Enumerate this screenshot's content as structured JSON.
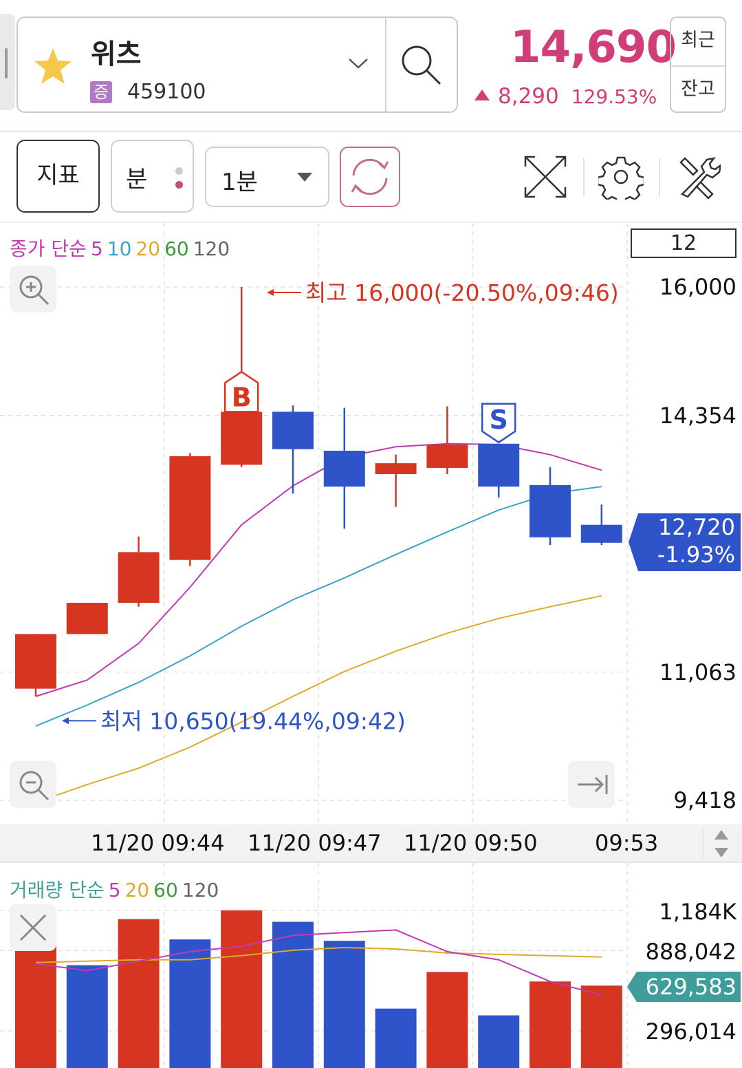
{
  "header": {
    "stock_name": "위츠",
    "market_badge": "증",
    "stock_code": "459100",
    "price": "14,690",
    "change": "8,290",
    "change_pct": "129.53%",
    "recent_label": "최근",
    "balance_label": "잔고"
  },
  "toolbar": {
    "indicator_label": "지표",
    "unit_label": "분",
    "period_value": "1분"
  },
  "colors": {
    "up": "#d63522",
    "down": "#2f54c9",
    "ma5": "#c13ab4",
    "ma10": "#3aa3c7",
    "ma20": "#e0a92b",
    "ma60": "#3c9a3c",
    "ma120": "#666666",
    "price_red": "#d13d78",
    "vol_tag": "#3f9e9b"
  },
  "chart_data": [
    {
      "type": "candlestick",
      "legend": [
        {
          "text": "종가 단순",
          "color": "#c13ab4"
        },
        {
          "text": "5",
          "color": "#c13ab4"
        },
        {
          "text": "10",
          "color": "#3aa3c7"
        },
        {
          "text": "20",
          "color": "#e0a92b"
        },
        {
          "text": "60",
          "color": "#3c9a3c"
        },
        {
          "text": "120",
          "color": "#666666"
        }
      ],
      "visible_count": "12",
      "y_ticks": [
        "16,000",
        "14,354",
        "11,063",
        "9,418"
      ],
      "y_tick_values": [
        16000,
        14354,
        11063,
        9418
      ],
      "x_ticks": [
        "11/20 09:44",
        "11/20 09:47",
        "11/20 09:50",
        "09:53"
      ],
      "x_tick_index": [
        3,
        6,
        9,
        12
      ],
      "candles": [
        {
          "open": 10850,
          "high": 11550,
          "low": 10750,
          "close": 11550
        },
        {
          "open": 11550,
          "high": 11950,
          "low": 11550,
          "close": 11950
        },
        {
          "open": 11950,
          "high": 12800,
          "low": 11900,
          "close": 12600
        },
        {
          "open": 12500,
          "high": 13870,
          "low": 12420,
          "close": 13830
        },
        {
          "open": 13720,
          "high": 16000,
          "low": 13690,
          "close": 14400
        },
        {
          "open": 14400,
          "high": 14480,
          "low": 13350,
          "close": 13920
        },
        {
          "open": 13900,
          "high": 14450,
          "low": 12900,
          "close": 13440
        },
        {
          "open": 13600,
          "high": 13850,
          "low": 13180,
          "close": 13740
        },
        {
          "open": 13680,
          "high": 14470,
          "low": 13600,
          "close": 13980
        },
        {
          "open": 13990,
          "high": 13990,
          "low": 13300,
          "close": 13440
        },
        {
          "open": 13460,
          "high": 13690,
          "low": 12690,
          "close": 12790
        },
        {
          "open": 12950,
          "high": 13210,
          "low": 12690,
          "close": 12720
        }
      ],
      "ma5": [
        10750,
        10960,
        11430,
        12150,
        12950,
        13450,
        13820,
        13950,
        13990,
        13980,
        13850,
        13650
      ],
      "ma10": [
        10370,
        10640,
        10930,
        11270,
        11650,
        11990,
        12270,
        12570,
        12860,
        13140,
        13350,
        13440
      ],
      "ma20": [
        9390,
        9620,
        9830,
        10100,
        10420,
        10750,
        11070,
        11330,
        11560,
        11750,
        11900,
        12040
      ],
      "high_annotation": "최고 16,000(-20.50%,09:46)",
      "low_annotation": "최저 10,650(19.44%,09:42)",
      "low_marker_value": 10650,
      "buy_marker": "B",
      "sell_marker": "S",
      "buy_index": 4,
      "sell_index": 9,
      "current_price": "12,720",
      "current_change": "-1.93%"
    },
    {
      "type": "bar",
      "legend": [
        {
          "text": "거래량 단순",
          "color": "#3f9e9b"
        },
        {
          "text": "5",
          "color": "#c13ab4"
        },
        {
          "text": "20",
          "color": "#e0a92b"
        },
        {
          "text": "60",
          "color": "#3c9a3c"
        },
        {
          "text": "120",
          "color": "#666666"
        }
      ],
      "y_ticks": [
        "1,184K",
        "888,042",
        "296,014"
      ],
      "y_tick_values": [
        1184000,
        888042,
        296014
      ],
      "values": [
        980000,
        780000,
        1120000,
        970000,
        1184000,
        1100000,
        960000,
        460000,
        730000,
        410000,
        660000,
        629583
      ],
      "up": [
        true,
        false,
        true,
        false,
        true,
        false,
        false,
        false,
        true,
        false,
        true,
        true
      ],
      "ma5": [
        790000,
        740000,
        810000,
        880000,
        920000,
        1000000,
        1020000,
        1040000,
        880000,
        820000,
        660000,
        560000
      ],
      "ma20": [
        800000,
        810000,
        820000,
        820000,
        850000,
        890000,
        910000,
        900000,
        870000,
        860000,
        850000,
        840000
      ],
      "current_volume": "629,583"
    }
  ]
}
